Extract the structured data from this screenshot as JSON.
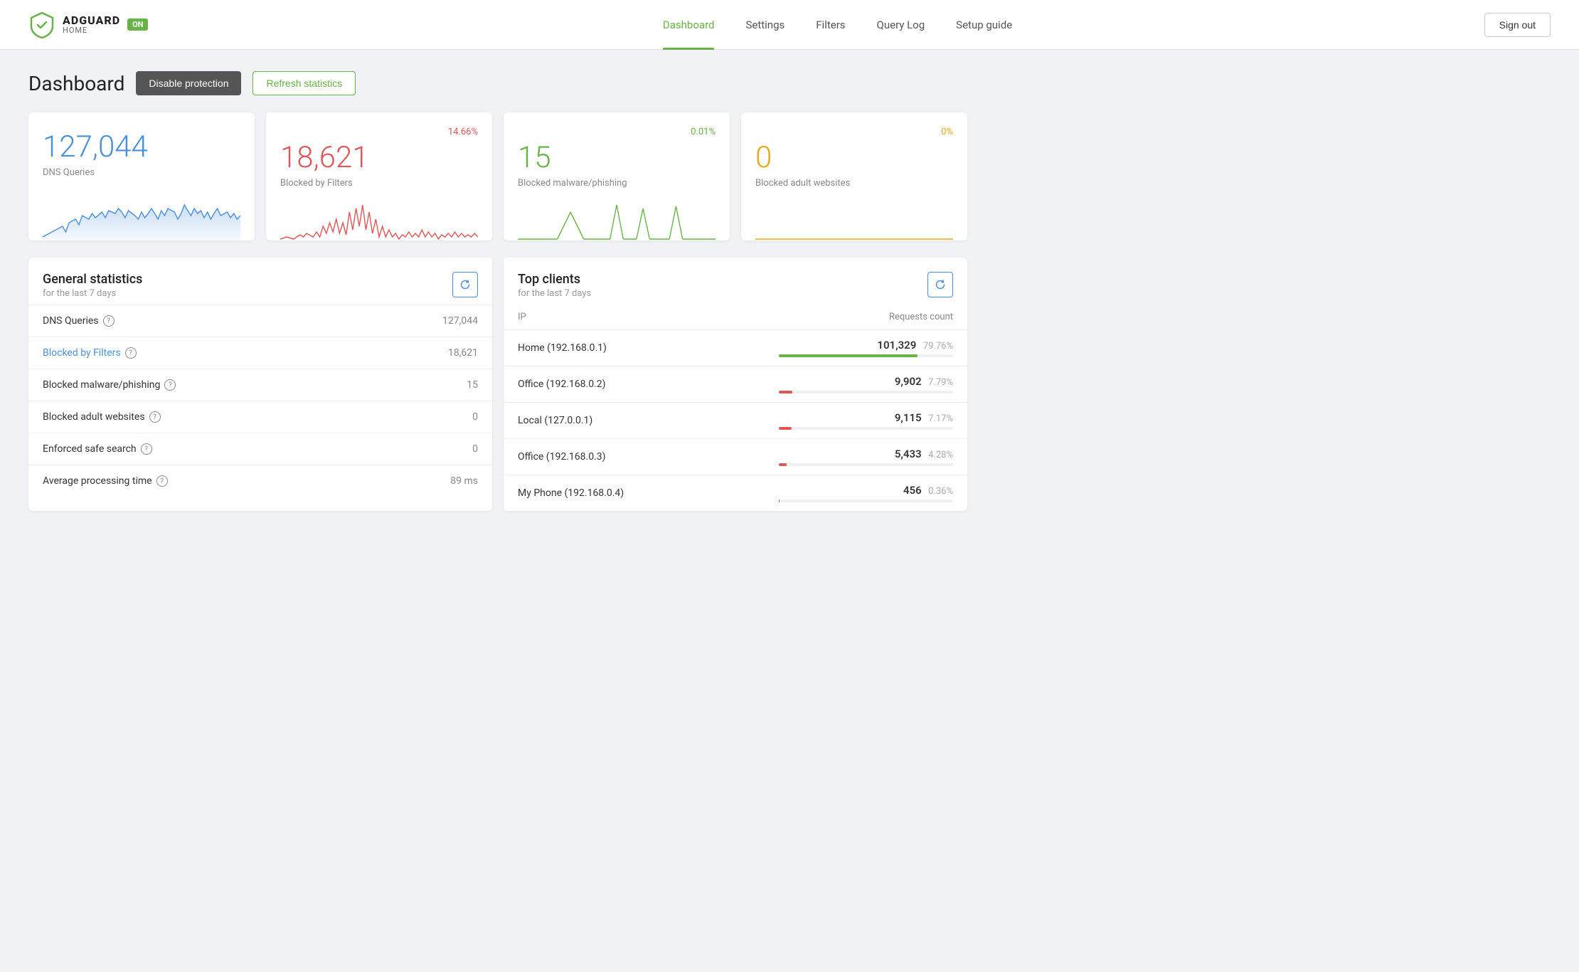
{
  "header": {
    "logo_main": "ADGUARD",
    "logo_sub": "HOME",
    "logo_badge": "ON",
    "nav": [
      {
        "label": "Dashboard",
        "active": true
      },
      {
        "label": "Settings",
        "active": false
      },
      {
        "label": "Filters",
        "active": false
      },
      {
        "label": "Query Log",
        "active": false
      },
      {
        "label": "Setup guide",
        "active": false
      }
    ],
    "sign_out": "Sign out"
  },
  "page": {
    "title": "Dashboard",
    "disable_protection": "Disable protection",
    "refresh_statistics": "Refresh statistics"
  },
  "stat_cards": [
    {
      "id": "dns-queries",
      "number": "127,044",
      "color": "blue",
      "label": "DNS Queries",
      "percent": "",
      "percent_color": ""
    },
    {
      "id": "blocked-filters",
      "number": "18,621",
      "color": "red",
      "label": "Blocked by Filters",
      "percent": "14.66%",
      "percent_color": "red"
    },
    {
      "id": "blocked-malware",
      "number": "15",
      "color": "green",
      "label": "Blocked malware/phishing",
      "percent": "0.01%",
      "percent_color": "green"
    },
    {
      "id": "blocked-adult",
      "number": "0",
      "color": "yellow",
      "label": "Blocked adult websites",
      "percent": "0%",
      "percent_color": "yellow"
    }
  ],
  "general_stats": {
    "title": "General statistics",
    "subtitle": "for the last 7 days",
    "rows": [
      {
        "label": "DNS Queries",
        "value": "127,044",
        "link": false
      },
      {
        "label": "Blocked by Filters",
        "value": "18,621",
        "link": true
      },
      {
        "label": "Blocked malware/phishing",
        "value": "15",
        "link": false
      },
      {
        "label": "Blocked adult websites",
        "value": "0",
        "link": false
      },
      {
        "label": "Enforced safe search",
        "value": "0",
        "link": false
      },
      {
        "label": "Average processing time",
        "value": "89 ms",
        "link": false
      }
    ]
  },
  "top_clients": {
    "title": "Top clients",
    "subtitle": "for the last 7 days",
    "columns": [
      "IP",
      "Requests count"
    ],
    "rows": [
      {
        "name": "Home (192.168.0.1)",
        "count": "101,329",
        "pct": "79.76%",
        "bar_pct": 79.76,
        "bar_color": "green"
      },
      {
        "name": "Office (192.168.0.2)",
        "count": "9,902",
        "pct": "7.79%",
        "bar_pct": 7.79,
        "bar_color": "red"
      },
      {
        "name": "Local (127.0.0.1)",
        "count": "9,115",
        "pct": "7.17%",
        "bar_pct": 7.17,
        "bar_color": "red"
      },
      {
        "name": "Office (192.168.0.3)",
        "count": "5,433",
        "pct": "4.28%",
        "bar_pct": 4.28,
        "bar_color": "red"
      },
      {
        "name": "My Phone (192.168.0.4)",
        "count": "456",
        "pct": "0.36%",
        "bar_pct": 0.36,
        "bar_color": "red"
      }
    ]
  }
}
